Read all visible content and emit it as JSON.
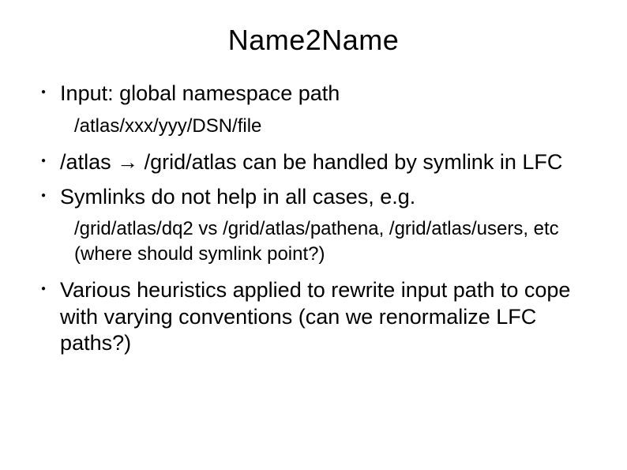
{
  "title": "Name2Name",
  "items": [
    {
      "bullet": "Input:  global namespace path",
      "sub": "/atlas/xxx/yyy/DSN/file"
    },
    {
      "bullet": "/atlas → /grid/atlas can be handled by symlink in LFC"
    },
    {
      "bullet": "Symlinks do not help in all cases, e.g.",
      "sub": "/grid/atlas/dq2 vs  /grid/atlas/pathena, /grid/atlas/users, etc (where should symlink point?)"
    },
    {
      "bullet": "Various heuristics applied to rewrite input path to cope with varying conventions (can we renormalize LFC paths?)"
    }
  ]
}
